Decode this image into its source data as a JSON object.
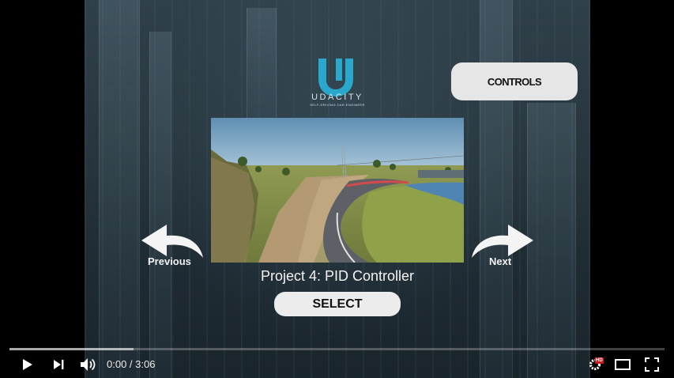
{
  "brand": {
    "name": "UDACITY",
    "tagline": "SELF-DRIVING CAR ENGINEER"
  },
  "menu": {
    "controls_label": "CONTROLS",
    "previous_label": "Previous",
    "next_label": "Next",
    "project_title": "Project 4: PID Controller",
    "select_label": "SELECT"
  },
  "player": {
    "time": "0:00 / 3:06",
    "loaded_fraction": 0.189,
    "hd_badge": "HD",
    "icons": [
      "play-icon",
      "next-icon",
      "volume-icon",
      "settings-icon",
      "theater-icon",
      "fullscreen-icon"
    ]
  },
  "colors": {
    "logo": "#2aa7cd",
    "hd_badge": "#cc181e"
  }
}
